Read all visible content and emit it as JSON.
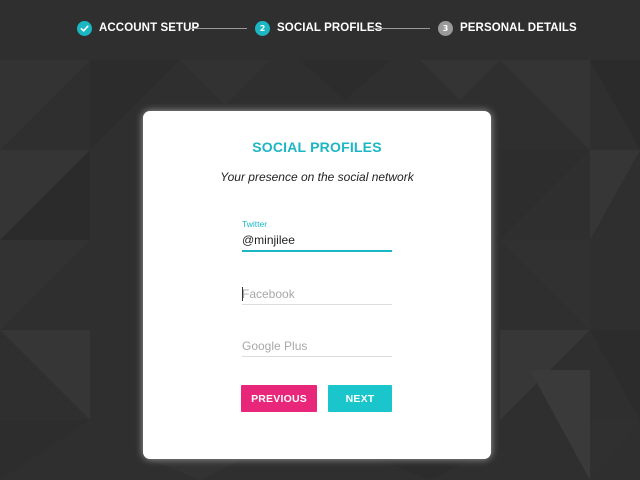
{
  "colors": {
    "accent": "#1bb7c4",
    "pink": "#e8267a",
    "background": "#2f2f2f",
    "step_done": "#1bb7c4",
    "step_current": "#1bb7c4",
    "step_pending": "#9a9a9a"
  },
  "stepper": {
    "steps": [
      {
        "number": "",
        "icon": "check-icon",
        "label": "ACCOUNT SETUP",
        "state": "done"
      },
      {
        "number": "2",
        "label": "SOCIAL PROFILES",
        "state": "current"
      },
      {
        "number": "3",
        "label": "PERSONAL DETAILS",
        "state": "pending"
      }
    ]
  },
  "card": {
    "title": "SOCIAL PROFILES",
    "subtitle": "Your presence on the social network",
    "fields": {
      "twitter": {
        "label": "Twitter",
        "value": "@minjilee",
        "placeholder": "Twitter"
      },
      "facebook": {
        "label": "",
        "value": "",
        "placeholder": "Facebook"
      },
      "google_plus": {
        "label": "",
        "value": "",
        "placeholder": "Google Plus"
      }
    },
    "buttons": {
      "previous": "PREVIOUS",
      "next": "NEXT"
    }
  }
}
